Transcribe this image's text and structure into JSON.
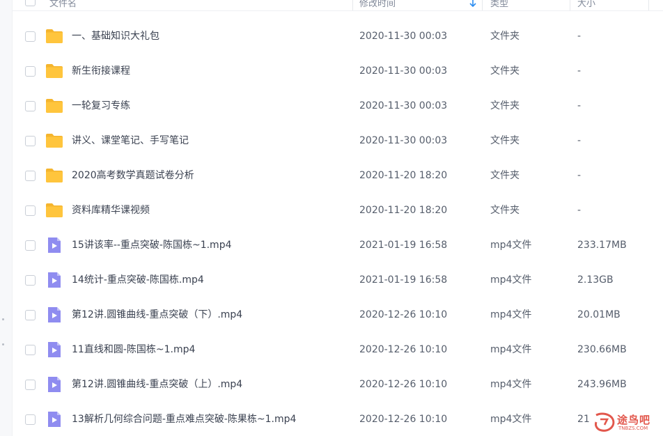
{
  "header": {
    "name": "文件名",
    "modified": "修改时间",
    "type": "类型",
    "size": "大小"
  },
  "files": [
    {
      "name": "一、基础知识大礼包",
      "modified": "2020-11-30 00:03",
      "type": "文件夹",
      "size": "-",
      "kind": "folder"
    },
    {
      "name": "新生衔接课程",
      "modified": "2020-11-30 00:03",
      "type": "文件夹",
      "size": "-",
      "kind": "folder"
    },
    {
      "name": "一轮复习专练",
      "modified": "2020-11-30 00:03",
      "type": "文件夹",
      "size": "-",
      "kind": "folder"
    },
    {
      "name": "讲义、课堂笔记、手写笔记",
      "modified": "2020-11-30 00:03",
      "type": "文件夹",
      "size": "-",
      "kind": "folder"
    },
    {
      "name": "2020高考数学真题试卷分析",
      "modified": "2020-11-20 18:20",
      "type": "文件夹",
      "size": "-",
      "kind": "folder"
    },
    {
      "name": "资料库精华课视频",
      "modified": "2020-11-20 18:20",
      "type": "文件夹",
      "size": "-",
      "kind": "folder"
    },
    {
      "name": "15讲该率--重点突破-陈国栋~1.mp4",
      "modified": "2021-01-19 16:58",
      "type": "mp4文件",
      "size": "233.17MB",
      "kind": "video"
    },
    {
      "name": "14统计-重点突破-陈国栋.mp4",
      "modified": "2021-01-19 16:58",
      "type": "mp4文件",
      "size": "2.13GB",
      "kind": "video"
    },
    {
      "name": "第12讲.圆锥曲线-重点突破（下）.mp4",
      "modified": "2020-12-26 10:10",
      "type": "mp4文件",
      "size": "20.01MB",
      "kind": "video"
    },
    {
      "name": "11直线和圆-陈国栋~1.mp4",
      "modified": "2020-12-26 10:10",
      "type": "mp4文件",
      "size": "230.66MB",
      "kind": "video"
    },
    {
      "name": "第12讲.圆锥曲线-重点突破（上）.mp4",
      "modified": "2020-12-26 10:10",
      "type": "mp4文件",
      "size": "243.96MB",
      "kind": "video"
    },
    {
      "name": "13解析几何综合问题-重点难点突破-陈果栋~1.mp4",
      "modified": "2020-12-26 10:10",
      "type": "mp4文件",
      "size": "21",
      "kind": "video"
    }
  ],
  "watermark": {
    "text": "途鸟吧",
    "sub": "TNBZS.COM"
  },
  "colors": {
    "folder": "#ffc53d",
    "folder_tab": "#f5b52e",
    "video": "#8f8cf0",
    "accent": "#2a8cf0"
  }
}
